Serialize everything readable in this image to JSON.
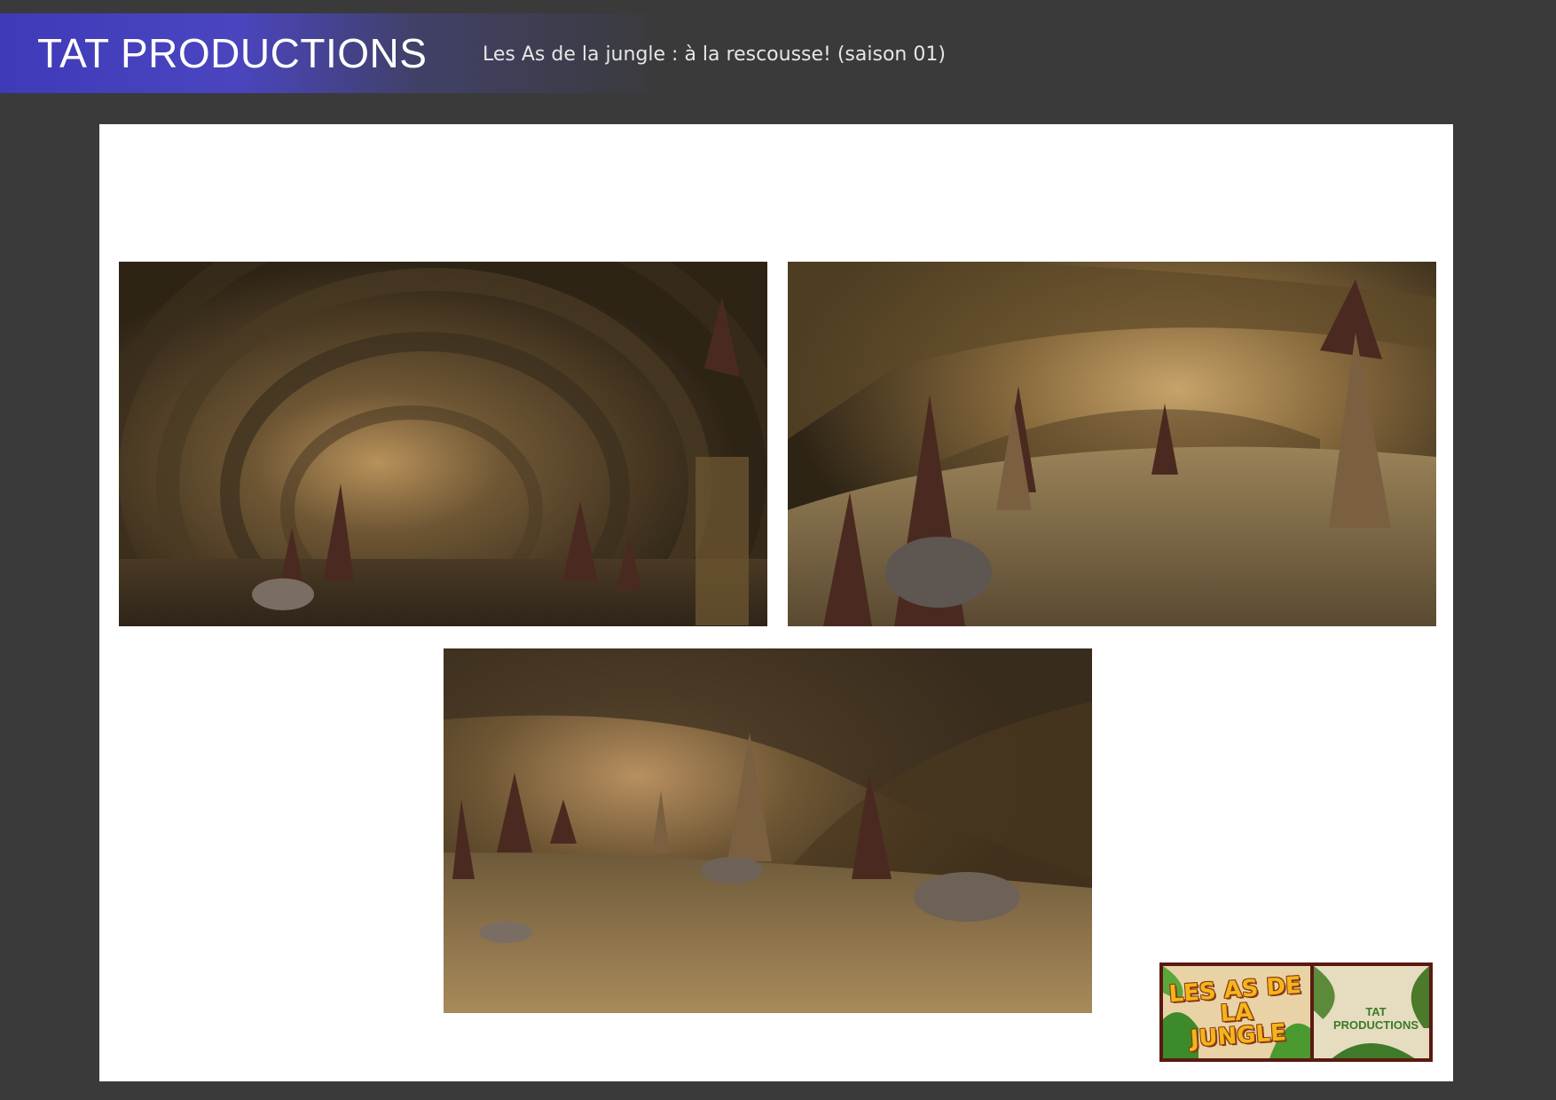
{
  "header": {
    "brand": "TAT PRODUCTIONS",
    "title": "Les As de la jungle : à la rescousse! (saison 01)"
  },
  "renders": [
    {
      "name": "cave-tunnel-render-1"
    },
    {
      "name": "cave-tunnel-render-2"
    },
    {
      "name": "cave-tunnel-render-3"
    }
  ],
  "logo": {
    "show_title": "LES AS DE LA JUNGLE",
    "studio": "TAT PRODUCTIONS"
  },
  "colors": {
    "background": "#3a3a3a",
    "brand_band": "#4a45bf",
    "sheet": "#ffffff",
    "logo_frame": "#5a1a12"
  }
}
